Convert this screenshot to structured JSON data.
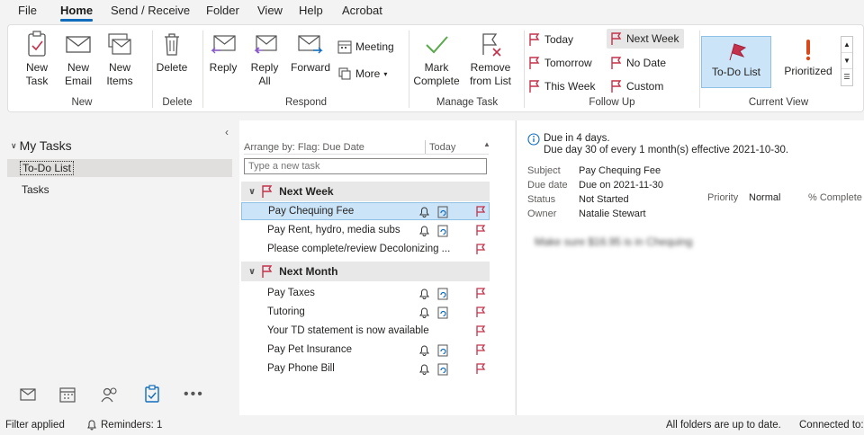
{
  "menu": [
    "File",
    "Home",
    "Send / Receive",
    "Folder",
    "View",
    "Help",
    "Acrobat"
  ],
  "ribbon": {
    "new": {
      "task": "New\nTask",
      "email": "New\nEmail",
      "items": "New\nItems",
      "group": "New"
    },
    "delete": {
      "label": "Delete",
      "group": "Delete"
    },
    "respond": {
      "reply": "Reply",
      "reply_all": "Reply\nAll",
      "forward": "Forward",
      "meeting": "Meeting",
      "more": "More",
      "group": "Respond"
    },
    "manage": {
      "mark_complete": "Mark\nComplete",
      "remove": "Remove\nfrom List",
      "group": "Manage Task"
    },
    "follow_up": {
      "today": "Today",
      "tomorrow": "Tomorrow",
      "this_week": "This Week",
      "next_week": "Next Week",
      "no_date": "No Date",
      "custom": "Custom",
      "group": "Follow Up"
    },
    "view": {
      "todo": "To-Do List",
      "prioritized": "Prioritized",
      "group": "Current View"
    }
  },
  "nav": {
    "header": "My Tasks",
    "items": [
      "To-Do List",
      "Tasks"
    ]
  },
  "tasklist": {
    "arrange": "Arrange by: Flag: Due Date",
    "sort": "Today",
    "placeholder": "Type a new task",
    "groups": [
      {
        "name": "Next Week",
        "tasks": [
          "Pay Chequing Fee",
          "Pay Rent, hydro, media subs",
          "Please complete/review Decolonizing ..."
        ]
      },
      {
        "name": "Next Month",
        "tasks": [
          "Pay Taxes",
          "Tutoring",
          "Your TD statement is now available",
          "Pay Pet Insurance",
          "Pay Phone Bill"
        ]
      }
    ]
  },
  "reading": {
    "due_line1": "Due in 4 days.",
    "due_line2": "Due day 30 of every 1 month(s) effective 2021-10-30.",
    "subject_label": "Subject",
    "subject": "Pay Chequing Fee",
    "due_label": "Due date",
    "due": "Due on 2021-11-30",
    "status_label": "Status",
    "status": "Not Started",
    "priority_label": "Priority",
    "priority": "Normal",
    "complete_label": "% Complete",
    "owner_label": "Owner",
    "owner": "Natalie Stewart",
    "body": "Make sure $16.95 is in Chequing"
  },
  "status": {
    "filter": "Filter applied",
    "reminders": "Reminders: 1",
    "sync": "All folders are up to date.",
    "connected": "Connected to:"
  },
  "colors": {
    "accent": "#0f6cbd",
    "flag": "#c4314b",
    "selected": "#cce4f7"
  }
}
